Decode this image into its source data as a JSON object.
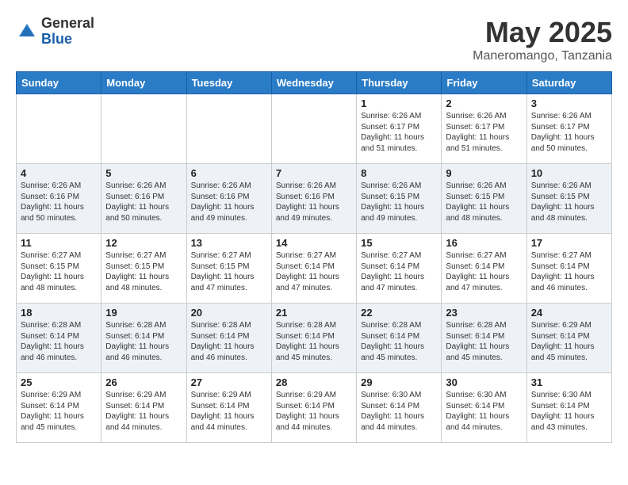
{
  "header": {
    "logo_general": "General",
    "logo_blue": "Blue",
    "title": "May 2025",
    "subtitle": "Maneromango, Tanzania"
  },
  "days_of_week": [
    "Sunday",
    "Monday",
    "Tuesday",
    "Wednesday",
    "Thursday",
    "Friday",
    "Saturday"
  ],
  "weeks": [
    [
      {
        "day": "",
        "info": ""
      },
      {
        "day": "",
        "info": ""
      },
      {
        "day": "",
        "info": ""
      },
      {
        "day": "",
        "info": ""
      },
      {
        "day": "1",
        "info": "Sunrise: 6:26 AM\nSunset: 6:17 PM\nDaylight: 11 hours\nand 51 minutes."
      },
      {
        "day": "2",
        "info": "Sunrise: 6:26 AM\nSunset: 6:17 PM\nDaylight: 11 hours\nand 51 minutes."
      },
      {
        "day": "3",
        "info": "Sunrise: 6:26 AM\nSunset: 6:17 PM\nDaylight: 11 hours\nand 50 minutes."
      }
    ],
    [
      {
        "day": "4",
        "info": "Sunrise: 6:26 AM\nSunset: 6:16 PM\nDaylight: 11 hours\nand 50 minutes."
      },
      {
        "day": "5",
        "info": "Sunrise: 6:26 AM\nSunset: 6:16 PM\nDaylight: 11 hours\nand 50 minutes."
      },
      {
        "day": "6",
        "info": "Sunrise: 6:26 AM\nSunset: 6:16 PM\nDaylight: 11 hours\nand 49 minutes."
      },
      {
        "day": "7",
        "info": "Sunrise: 6:26 AM\nSunset: 6:16 PM\nDaylight: 11 hours\nand 49 minutes."
      },
      {
        "day": "8",
        "info": "Sunrise: 6:26 AM\nSunset: 6:15 PM\nDaylight: 11 hours\nand 49 minutes."
      },
      {
        "day": "9",
        "info": "Sunrise: 6:26 AM\nSunset: 6:15 PM\nDaylight: 11 hours\nand 48 minutes."
      },
      {
        "day": "10",
        "info": "Sunrise: 6:26 AM\nSunset: 6:15 PM\nDaylight: 11 hours\nand 48 minutes."
      }
    ],
    [
      {
        "day": "11",
        "info": "Sunrise: 6:27 AM\nSunset: 6:15 PM\nDaylight: 11 hours\nand 48 minutes."
      },
      {
        "day": "12",
        "info": "Sunrise: 6:27 AM\nSunset: 6:15 PM\nDaylight: 11 hours\nand 48 minutes."
      },
      {
        "day": "13",
        "info": "Sunrise: 6:27 AM\nSunset: 6:15 PM\nDaylight: 11 hours\nand 47 minutes."
      },
      {
        "day": "14",
        "info": "Sunrise: 6:27 AM\nSunset: 6:14 PM\nDaylight: 11 hours\nand 47 minutes."
      },
      {
        "day": "15",
        "info": "Sunrise: 6:27 AM\nSunset: 6:14 PM\nDaylight: 11 hours\nand 47 minutes."
      },
      {
        "day": "16",
        "info": "Sunrise: 6:27 AM\nSunset: 6:14 PM\nDaylight: 11 hours\nand 47 minutes."
      },
      {
        "day": "17",
        "info": "Sunrise: 6:27 AM\nSunset: 6:14 PM\nDaylight: 11 hours\nand 46 minutes."
      }
    ],
    [
      {
        "day": "18",
        "info": "Sunrise: 6:28 AM\nSunset: 6:14 PM\nDaylight: 11 hours\nand 46 minutes."
      },
      {
        "day": "19",
        "info": "Sunrise: 6:28 AM\nSunset: 6:14 PM\nDaylight: 11 hours\nand 46 minutes."
      },
      {
        "day": "20",
        "info": "Sunrise: 6:28 AM\nSunset: 6:14 PM\nDaylight: 11 hours\nand 46 minutes."
      },
      {
        "day": "21",
        "info": "Sunrise: 6:28 AM\nSunset: 6:14 PM\nDaylight: 11 hours\nand 45 minutes."
      },
      {
        "day": "22",
        "info": "Sunrise: 6:28 AM\nSunset: 6:14 PM\nDaylight: 11 hours\nand 45 minutes."
      },
      {
        "day": "23",
        "info": "Sunrise: 6:28 AM\nSunset: 6:14 PM\nDaylight: 11 hours\nand 45 minutes."
      },
      {
        "day": "24",
        "info": "Sunrise: 6:29 AM\nSunset: 6:14 PM\nDaylight: 11 hours\nand 45 minutes."
      }
    ],
    [
      {
        "day": "25",
        "info": "Sunrise: 6:29 AM\nSunset: 6:14 PM\nDaylight: 11 hours\nand 45 minutes."
      },
      {
        "day": "26",
        "info": "Sunrise: 6:29 AM\nSunset: 6:14 PM\nDaylight: 11 hours\nand 44 minutes."
      },
      {
        "day": "27",
        "info": "Sunrise: 6:29 AM\nSunset: 6:14 PM\nDaylight: 11 hours\nand 44 minutes."
      },
      {
        "day": "28",
        "info": "Sunrise: 6:29 AM\nSunset: 6:14 PM\nDaylight: 11 hours\nand 44 minutes."
      },
      {
        "day": "29",
        "info": "Sunrise: 6:30 AM\nSunset: 6:14 PM\nDaylight: 11 hours\nand 44 minutes."
      },
      {
        "day": "30",
        "info": "Sunrise: 6:30 AM\nSunset: 6:14 PM\nDaylight: 11 hours\nand 44 minutes."
      },
      {
        "day": "31",
        "info": "Sunrise: 6:30 AM\nSunset: 6:14 PM\nDaylight: 11 hours\nand 43 minutes."
      }
    ]
  ]
}
